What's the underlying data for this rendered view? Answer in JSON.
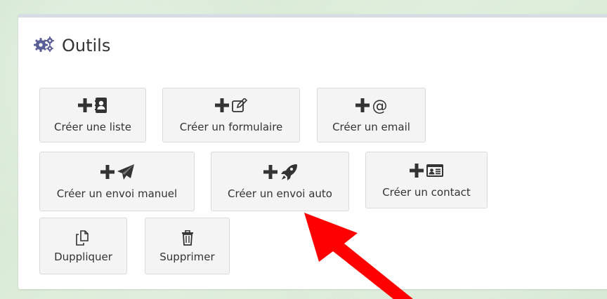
{
  "panel": {
    "title": "Outils",
    "title_icon": "gears-icon"
  },
  "buttons": [
    {
      "id": "create-list",
      "label": "Créer une liste",
      "icon": "address-book-icon"
    },
    {
      "id": "create-form",
      "label": "Créer un formulaire",
      "icon": "edit-icon"
    },
    {
      "id": "create-email",
      "label": "Créer un email",
      "icon": "at-icon"
    },
    {
      "id": "create-manual-send",
      "label": "Créer un envoi manuel",
      "icon": "paper-plane-icon"
    },
    {
      "id": "create-auto-send",
      "label": "Créer un envoi auto",
      "icon": "rocket-icon"
    },
    {
      "id": "create-contact",
      "label": "Créer un contact",
      "icon": "id-card-icon"
    },
    {
      "id": "duplicate",
      "label": "Duppliquer",
      "icon": "copy-icon"
    },
    {
      "id": "delete",
      "label": "Supprimer",
      "icon": "trash-icon"
    }
  ],
  "colors": {
    "icon_purple": "#5b5e95",
    "arrow_red": "#ff0000",
    "button_bg": "#f4f4f4",
    "text": "#333333"
  }
}
